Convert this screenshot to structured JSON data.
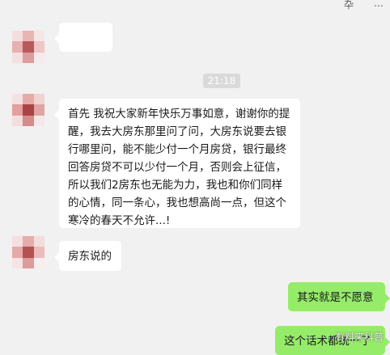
{
  "topbar": {
    "icon_a": "卆",
    "icon_b": "…"
  },
  "messages": [
    {
      "side": "left",
      "text": ""
    },
    {
      "side": "left",
      "text": "首先 我祝大家新年快乐万事如意，谢谢你的提醒，我去大房东那里问了问，大房东说要去银行哪里问，能不能少付一个月房贷，银行最终回答房贷不可以少付一个月，否则会上征信，所以我们2房东也无能为力，我也和你们同样的心情，同一条心，我也想高尚一点，但这个寒冷的春天不允许...!"
    },
    {
      "side": "left",
      "text": "房东说的"
    },
    {
      "side": "right",
      "text": "其实就是不愿意"
    },
    {
      "side": "right",
      "text": "这个话术都统一了"
    }
  ],
  "timestamp": "21:18",
  "watermark": "有料来科普",
  "colors": {
    "background": "#f1f1f1",
    "incoming_bubble": "#ffffff",
    "outgoing_bubble": "#95ec69",
    "time_pill": "#dadada"
  },
  "icons": [
    "minimize-icon",
    "more-icon"
  ]
}
